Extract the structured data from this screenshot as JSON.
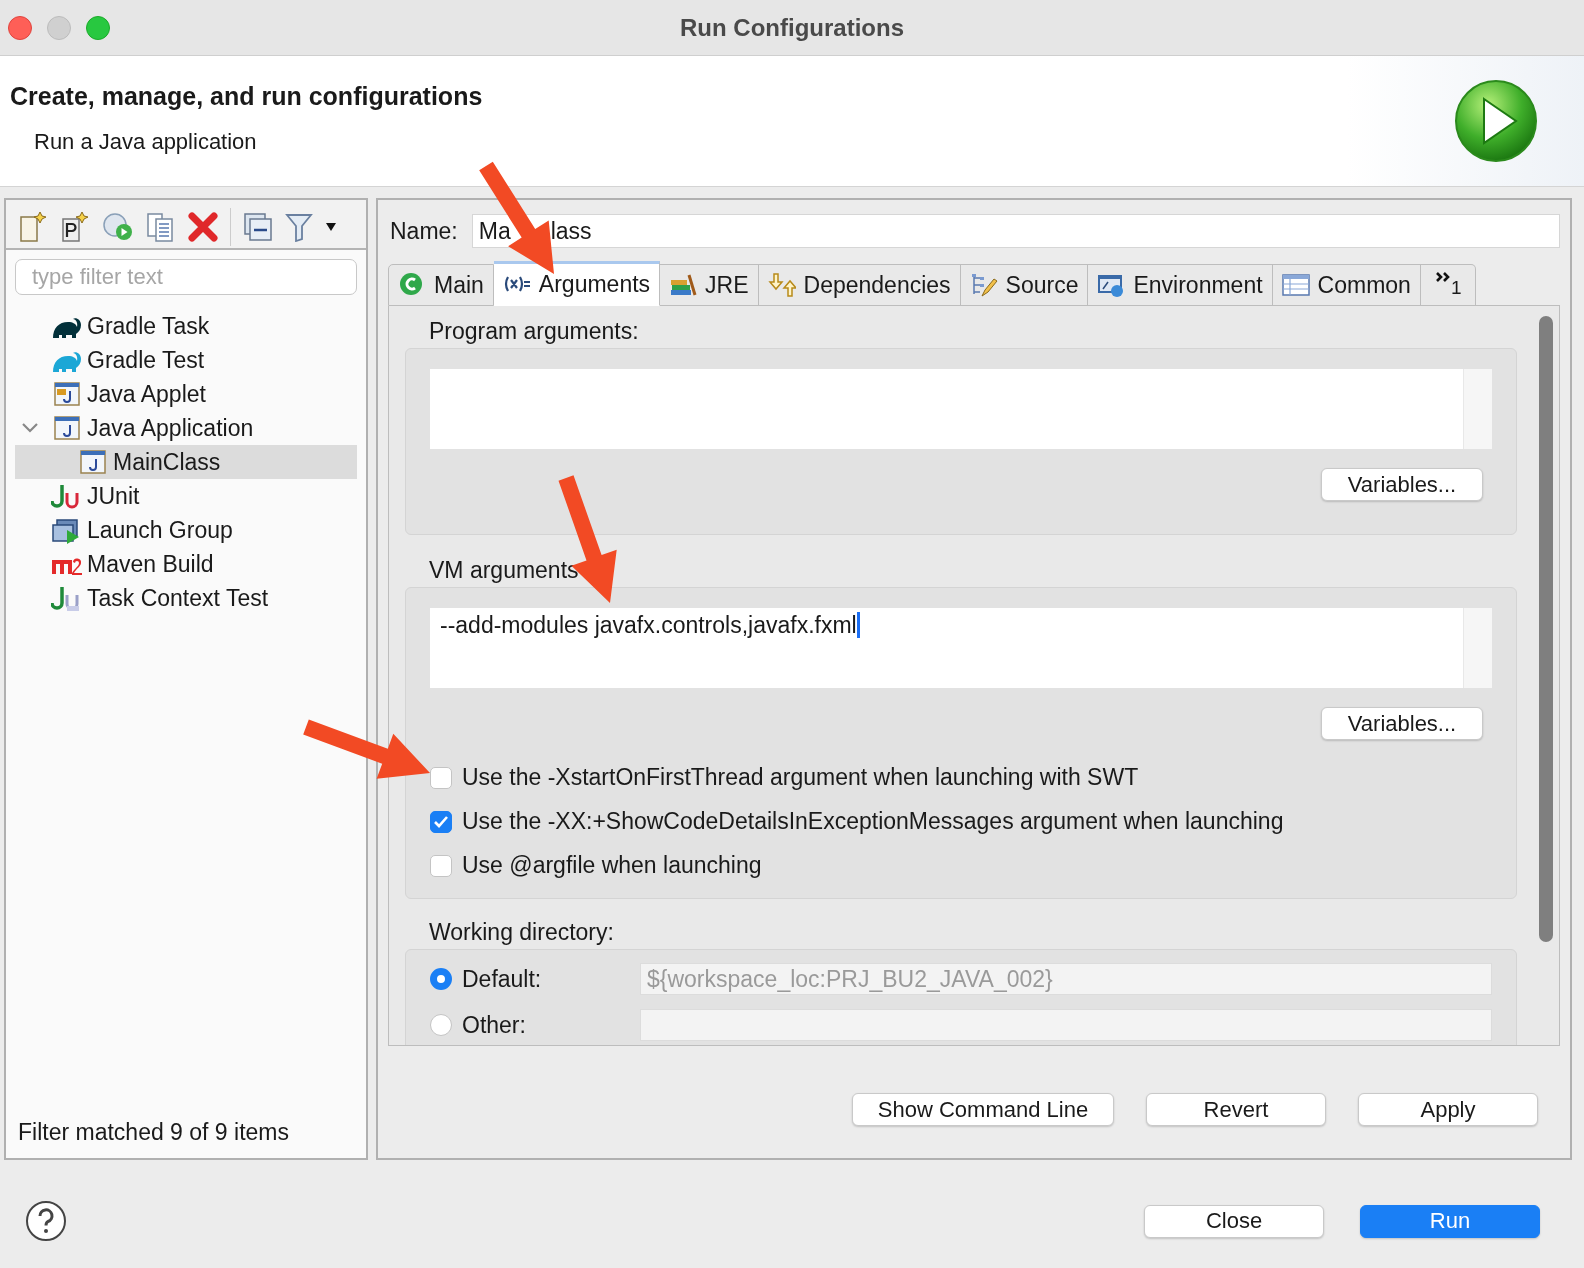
{
  "window": {
    "title": "Run Configurations"
  },
  "header": {
    "title": "Create, manage, and run configurations",
    "subtitle": "Run a Java application"
  },
  "sidebar": {
    "filter": {
      "placeholder": "type filter text"
    },
    "items": [
      {
        "label": "Gradle Task",
        "selected": false
      },
      {
        "label": "Gradle Test",
        "selected": false
      },
      {
        "label": "Java Applet",
        "selected": false
      },
      {
        "label": "Java Application",
        "selected": false,
        "expanded": true,
        "children": [
          {
            "label": "MainClass",
            "selected": true
          }
        ]
      },
      {
        "label": "JUnit",
        "selected": false
      },
      {
        "label": "Launch Group",
        "selected": false
      },
      {
        "label": "Maven Build",
        "selected": false
      },
      {
        "label": "Task Context Test",
        "selected": false
      }
    ],
    "status": "Filter matched 9 of 9 items"
  },
  "name": {
    "label": "Name:",
    "value_parts": [
      "Ma",
      "lass"
    ]
  },
  "tabs": [
    {
      "label": "Main",
      "selected": false
    },
    {
      "label": "Arguments",
      "selected": true
    },
    {
      "label": "JRE",
      "selected": false
    },
    {
      "label": "Dependencies",
      "selected": false
    },
    {
      "label": "Source",
      "selected": false
    },
    {
      "label": "Environment",
      "selected": false
    },
    {
      "label": "Common",
      "selected": false
    }
  ],
  "overflow_tab": {
    "count": "1"
  },
  "program_arguments": {
    "label": "Program arguments:",
    "button": "Variables..."
  },
  "vm_arguments": {
    "label": "VM arguments",
    "value": "--add-modules javafx.controls,javafx.fxml",
    "button": "Variables..."
  },
  "options": [
    {
      "label": "Use the -XstartOnFirstThread argument when launching with SWT",
      "checked": false
    },
    {
      "label": "Use the -XX:+ShowCodeDetailsInExceptionMessages argument when launching",
      "checked": true
    },
    {
      "label": "Use @argfile when launching",
      "checked": false
    }
  ],
  "working_directory": {
    "label": "Working directory:",
    "choices": [
      {
        "label": "Default:",
        "selected": true,
        "value": "${workspace_loc:PRJ_BU2_JAVA_002}",
        "disabled": true
      },
      {
        "label": "Other:",
        "selected": false,
        "disabled": true
      }
    ]
  },
  "actions": [
    "Show Command Line",
    "Revert",
    "Apply"
  ],
  "footer_buttons": [
    {
      "label": "Close",
      "primary": false
    },
    {
      "label": "Run",
      "primary": true
    }
  ]
}
